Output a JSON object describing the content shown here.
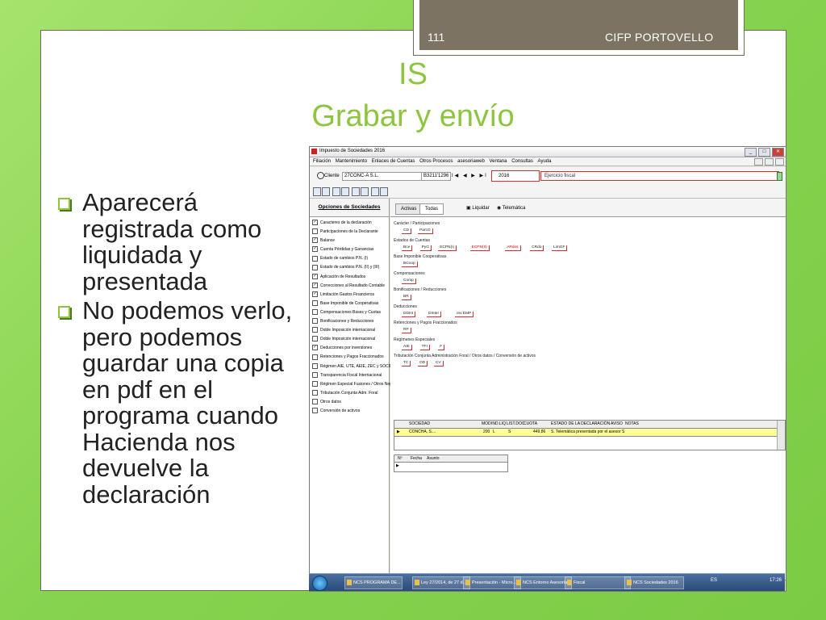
{
  "slide": {
    "page_number": "111",
    "organization": "CIFP PORTOVELLO",
    "title_line1": "IS",
    "title_line2": "Grabar y envío",
    "bullets": [
      "Aparecerá registrada como liquidada y presentada",
      "No podemos verlo, pero podemos guardar una copia en pdf en el programa cuando Hacienda nos devuelve la declaración"
    ]
  },
  "app": {
    "window_title": "Impuesto de Sociedades 2016",
    "menu": [
      "Filiación",
      "Mantenimiento",
      "Enlaces de Cuentas",
      "Otros Procesos",
      "asesoriaweb",
      "Ventana",
      "Consultas",
      "Ayuda"
    ],
    "client_label": "Cliente",
    "client_name": "27CONC-A S.L.",
    "client_nif": "B3211'1296",
    "nav_arrows": "I◀ ◀ ▶ ▶I",
    "year": "2016",
    "ejercicio_text": "Ejercicio fiscal",
    "left_panel": {
      "title": "Opciones de Sociedades",
      "items": [
        {
          "label": "Caracteres de la declaración",
          "checked": true
        },
        {
          "label": "Participaciones de la Declarante",
          "checked": false
        },
        {
          "label": "Balance",
          "checked": true
        },
        {
          "label": "Cuenta Pérdidas y Ganancias",
          "checked": true
        },
        {
          "label": "Estado de cambios P.N. (I)",
          "checked": false
        },
        {
          "label": "Estado de cambios P.N. (II) y (III)",
          "checked": false
        },
        {
          "label": "Aplicación de Resultados",
          "checked": true
        },
        {
          "label": "Correcciones al Resultado Contable",
          "checked": true
        },
        {
          "label": "Limitación Gastos Financieros",
          "checked": true
        },
        {
          "label": "Base Imponible de Cooperativas",
          "checked": false
        },
        {
          "label": "Compensaciones Bases y Cuotas",
          "checked": false
        },
        {
          "label": "Bonificaciones y Reducciones",
          "checked": false
        },
        {
          "label": "Doble Imposición internacional",
          "checked": false
        },
        {
          "label": "Doble Imposición internacional",
          "checked": false
        },
        {
          "label": "Deducciones por inversiones",
          "checked": true
        },
        {
          "label": "Retenciones y Pagos Fraccionados",
          "checked": false
        },
        {
          "label": "Régimen AIE, UTE, AEIE, ZEC y SOCIMI",
          "checked": false
        },
        {
          "label": "Transparencia Fiscal Internacional",
          "checked": false
        },
        {
          "label": "Régimen Especial Fusiones / Otros Negocios",
          "checked": false
        },
        {
          "label": "Tributación Conjunta Adm. Foral",
          "checked": false
        },
        {
          "label": "Otros datos",
          "checked": false
        },
        {
          "label": "Conversión de activos",
          "checked": false
        }
      ]
    },
    "tabs": [
      "Activas",
      "Todas"
    ],
    "liquidar_label": "Liquidar",
    "telematica_label": "Telemática",
    "sections": [
      {
        "title": "Carácter / Participaciones",
        "buttons": [
          "CD",
          "Part.D"
        ]
      },
      {
        "title": "Estados de Cuentas",
        "buttons": [
          "Bce",
          "PyG",
          "ECPN(I)",
          "ECPN(II)",
          "ARdos",
          "CRdo",
          "LimGF"
        ]
      },
      {
        "title": "Base Imponible Cooperativas",
        "buttons": [
          "BCoop"
        ]
      },
      {
        "title": "Compensaciones",
        "buttons": [
          "Comp"
        ]
      },
      {
        "title": "Bonificaciones / Reducciones",
        "buttons": [
          "BR"
        ]
      },
      {
        "title": "Deducciones",
        "buttons": [
          "DDInt",
          "DInter",
          "Inv EMP"
        ]
      },
      {
        "title": "Retenciones y Pagos Fraccionados",
        "buttons": [
          "RP"
        ]
      },
      {
        "title": "Regímenes Especiales",
        "buttons": [
          "AIE",
          "TFI",
          "F"
        ]
      },
      {
        "title": "Tributación Conjunta Administración Foral / Otros datos / Conversión de activos",
        "buttons": [
          "TC",
          "OD",
          "CV"
        ]
      }
    ],
    "grid": {
      "headers": [
        "SOCIEDAD",
        "MOD",
        "IND.LIQ",
        "LIST.DOC",
        "CUOTA",
        "ESTADO DE LA DECLARACIÓN",
        "AVISO",
        "NOTAS"
      ],
      "row": [
        "CONCHA, S....",
        "200",
        "L",
        "S",
        "449,86",
        "S. Telemática presentada por el asesor S"
      ]
    },
    "grid2_headers": [
      "Nº",
      "Fecha",
      "Asunto"
    ],
    "taskbar": {
      "items": [
        "NCS PROGRAMA DE...",
        "Ley 27/2014, de 27 d...",
        "Presentación - Micro...",
        "NCS Entorno Asesorías",
        "Fiscal",
        "NCS Sociedades 2016"
      ],
      "lang": "ES",
      "time": "17:26"
    }
  }
}
